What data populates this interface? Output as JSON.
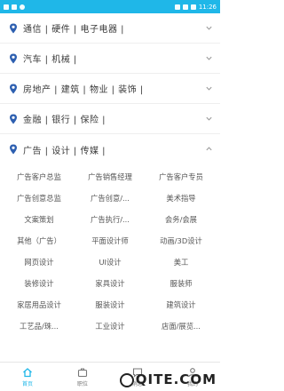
{
  "status": {
    "time": "11:26"
  },
  "categories": [
    {
      "label": "通信 | 硬件 | 电子电器 |"
    },
    {
      "label": "汽车 | 机械 |"
    },
    {
      "label": "房地产 | 建筑 | 物业 | 装饰 |"
    },
    {
      "label": "金融 | 银行 | 保险 |"
    },
    {
      "label": "广告 | 设计 | 传媒 |"
    }
  ],
  "jobs": [
    "广告客户总监",
    "广告销售经理",
    "广告客户专员",
    "广告创意总监",
    "广告创意/...",
    "美术指导",
    "文案策划",
    "广告执行/...",
    "会务/会展",
    "其他（广告）",
    "平面设计师",
    "动画/3D设计",
    "网页设计",
    "UI设计",
    "美工",
    "装修设计",
    "家具设计",
    "服装师",
    "家居用品设计",
    "服装设计",
    "建筑设计",
    "工艺品/珠...",
    "工业设计",
    "店面/展览..."
  ],
  "tabs": [
    {
      "label": "首页"
    },
    {
      "label": "职位"
    },
    {
      "label": "消息"
    },
    {
      "label": "我的"
    }
  ],
  "watermark": "QITE.COM",
  "colors": {
    "accent": "#1fb7e8",
    "pin": "#2d5fb0"
  }
}
